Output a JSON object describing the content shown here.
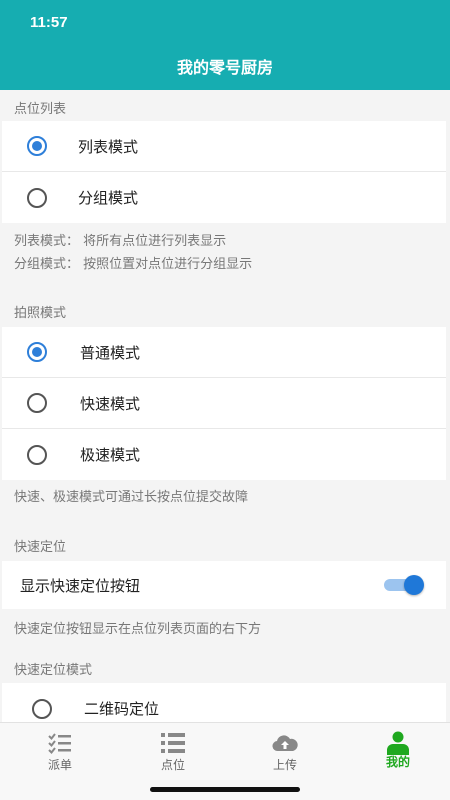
{
  "status": {
    "time": "11:57"
  },
  "header": {
    "title": "我的零号厨房"
  },
  "list_section": {
    "label": "点位列表",
    "options": [
      {
        "label": "列表模式",
        "checked": true
      },
      {
        "label": "分组模式",
        "checked": false
      }
    ],
    "desc_1": "列表模式：  将所有点位进行列表显示",
    "desc_2": "分组模式：  按照位置对点位进行分组显示"
  },
  "photo_section": {
    "label": "拍照模式",
    "options": [
      {
        "label": "普通模式",
        "checked": true
      },
      {
        "label": "快速模式",
        "checked": false
      },
      {
        "label": "极速模式",
        "checked": false
      }
    ],
    "desc": "快速、极速模式可通过长按点位提交故障"
  },
  "locate_section": {
    "label": "快速定位",
    "toggle_label": "显示快速定位按钮",
    "toggle_on": true,
    "desc": "快速定位按钮显示在点位列表页面的右下方"
  },
  "locate_mode_section": {
    "label": "快速定位模式",
    "options": [
      {
        "label": "二维码定位",
        "checked": false
      }
    ]
  },
  "tabbar": {
    "tabs": [
      {
        "label": "派单",
        "icon": "checklist-icon"
      },
      {
        "label": "点位",
        "icon": "list-icon"
      },
      {
        "label": "上传",
        "icon": "cloud-upload-icon"
      },
      {
        "label": "我的",
        "icon": "person-icon"
      }
    ],
    "active_color": "#1fa81f"
  },
  "colors": {
    "header": "#16adb1",
    "radio": "#2e7fd9",
    "toggle": "#1f78d8"
  }
}
